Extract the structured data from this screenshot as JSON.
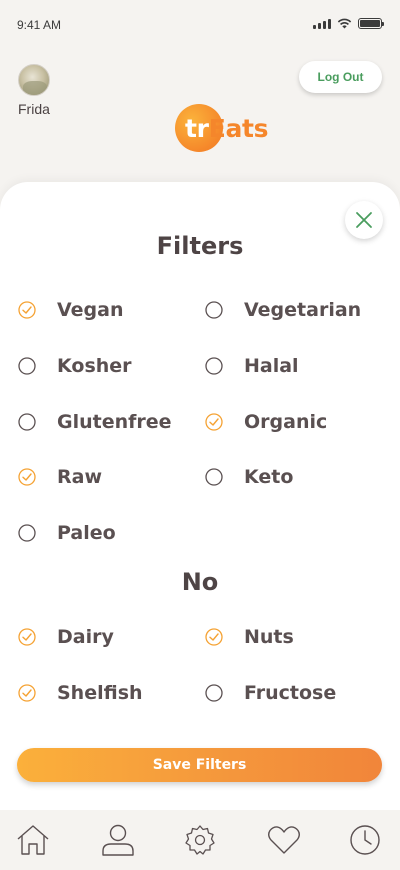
{
  "status_bar": {
    "time": "9:41 AM"
  },
  "header": {
    "user_name": "Frida",
    "logout_label": "Log Out",
    "logo": {
      "prefix": "tr",
      "suffix": "Eats"
    }
  },
  "filters": {
    "title": "Filters",
    "options": [
      {
        "label": "Vegan",
        "checked": true
      },
      {
        "label": "Vegetarian",
        "checked": false
      },
      {
        "label": "Kosher",
        "checked": false
      },
      {
        "label": "Halal",
        "checked": false
      },
      {
        "label": "Glutenfree",
        "checked": false
      },
      {
        "label": "Organic",
        "checked": true
      },
      {
        "label": "Raw",
        "checked": true
      },
      {
        "label": "Keto",
        "checked": false
      },
      {
        "label": "Paleo",
        "checked": false
      }
    ]
  },
  "exclusions": {
    "title": "No",
    "options": [
      {
        "label": "Dairy",
        "checked": true
      },
      {
        "label": "Nuts",
        "checked": true
      },
      {
        "label": "Shelfish",
        "checked": true
      },
      {
        "label": "Fructose",
        "checked": false
      }
    ]
  },
  "save_label": "Save Filters",
  "colors": {
    "accent": "#f59a3c",
    "check": "#f5a233",
    "logout_text": "#4a9d5e",
    "text": "#5a5051"
  },
  "nav": [
    "home-icon",
    "profile-icon",
    "settings-icon",
    "favorites-icon",
    "history-icon"
  ]
}
